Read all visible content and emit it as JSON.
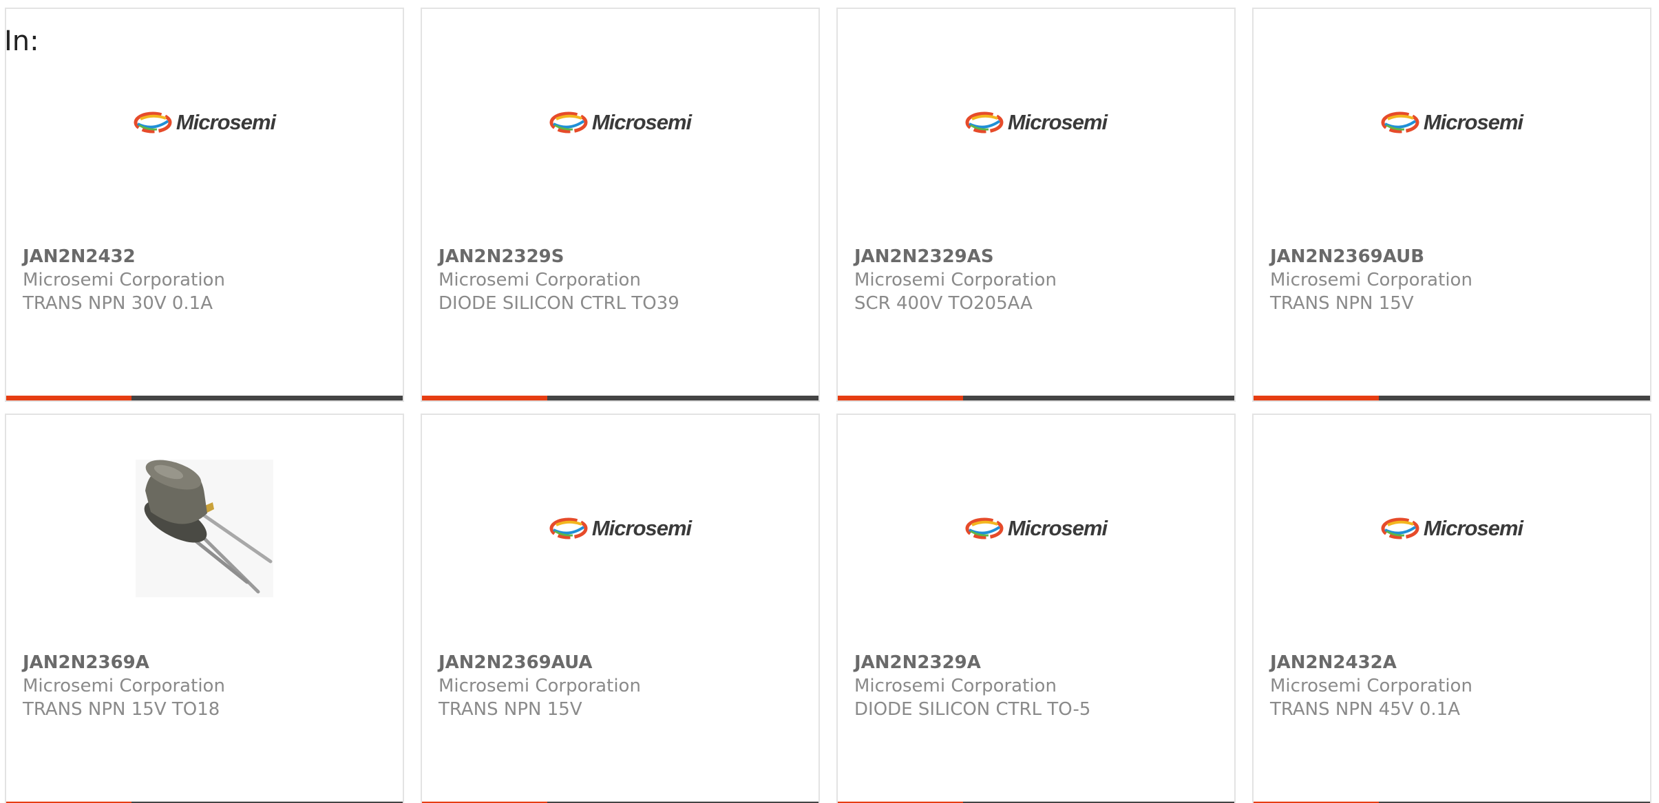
{
  "filter": {
    "label": "In:"
  },
  "brand_logo_text": "Microsemi",
  "colors": {
    "accent": "#e63d12",
    "bar": "#444444",
    "border": "#e3e3e3"
  },
  "products": [
    {
      "part": "JAN2N2432",
      "maker": "Microsemi Corporation",
      "desc": "TRANS NPN 30V 0.1A",
      "image": "microsemi-logo"
    },
    {
      "part": "JAN2N2329S",
      "maker": "Microsemi Corporation",
      "desc": "DIODE SILICON CTRL TO39",
      "image": "microsemi-logo"
    },
    {
      "part": "JAN2N2329AS",
      "maker": "Microsemi Corporation",
      "desc": "SCR 400V TO205AA",
      "image": "microsemi-logo"
    },
    {
      "part": "JAN2N2369AUB",
      "maker": "Microsemi Corporation",
      "desc": "TRANS NPN 15V",
      "image": "microsemi-logo"
    },
    {
      "part": "JAN2N2369A",
      "maker": "Microsemi Corporation",
      "desc": "TRANS NPN 15V TO18",
      "image": "to18-transistor-photo"
    },
    {
      "part": "JAN2N2369AUA",
      "maker": "Microsemi Corporation",
      "desc": "TRANS NPN 15V",
      "image": "microsemi-logo"
    },
    {
      "part": "JAN2N2329A",
      "maker": "Microsemi Corporation",
      "desc": "DIODE SILICON CTRL TO-5",
      "image": "microsemi-logo"
    },
    {
      "part": "JAN2N2432A",
      "maker": "Microsemi Corporation",
      "desc": "TRANS NPN 45V 0.1A",
      "image": "microsemi-logo"
    }
  ]
}
